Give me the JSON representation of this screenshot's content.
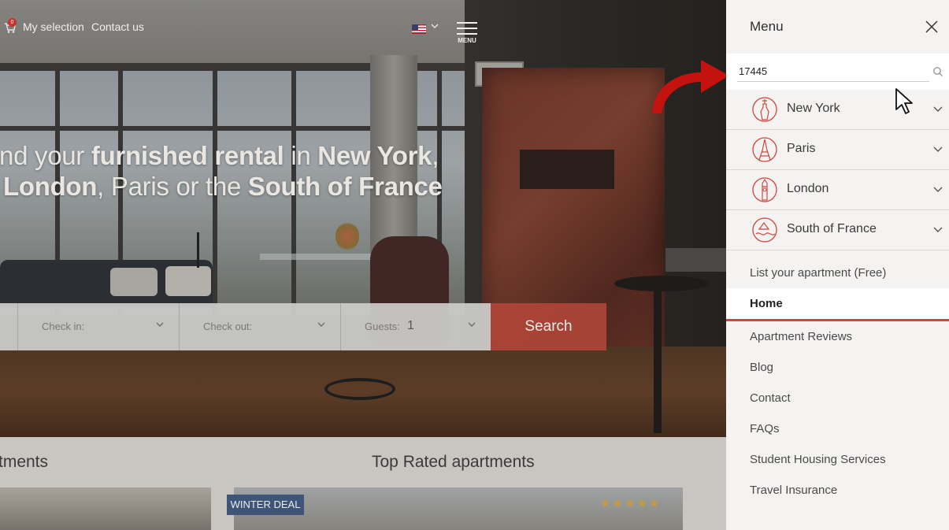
{
  "topbar": {
    "cart_count": "0",
    "selection_label": "My selection",
    "contact_label": "Contact us",
    "menu_label": "MENU"
  },
  "hero": {
    "headline_parts": {
      "p1": "ind your ",
      "b1": "furnished rental",
      "p2": " in ",
      "b2": "New York",
      "p3": ",",
      "b3": "London",
      "p4": ", Paris or the ",
      "b4": "South of France"
    }
  },
  "searchbar": {
    "checkin_label": "Check in:",
    "checkout_label": "Check out:",
    "guests_label": "Guests:",
    "guests_value": "1",
    "search_label": "Search"
  },
  "lower": {
    "left_title": "tments",
    "center_title": "Top Rated apartments",
    "deal_badge": "WINTER DEAL",
    "stars": "★★★★★"
  },
  "side_menu": {
    "title": "Menu",
    "search_value": "17445",
    "cities": [
      {
        "label": "New York",
        "icon": "statue-of-liberty-icon"
      },
      {
        "label": "Paris",
        "icon": "eiffel-tower-icon"
      },
      {
        "label": "London",
        "icon": "big-ben-icon"
      },
      {
        "label": "South of France",
        "icon": "south-of-france-icon"
      }
    ],
    "list_apartment": "List your apartment (Free)",
    "home": "Home",
    "items": [
      "Apartment Reviews",
      "Blog",
      "Contact",
      "FAQs",
      "Student Housing Services",
      "Travel Insurance"
    ]
  },
  "colors": {
    "accent_red": "#d0453c",
    "search_btn": "#b04639",
    "deal_badge": "#3e5577",
    "star": "#c99a3d"
  }
}
